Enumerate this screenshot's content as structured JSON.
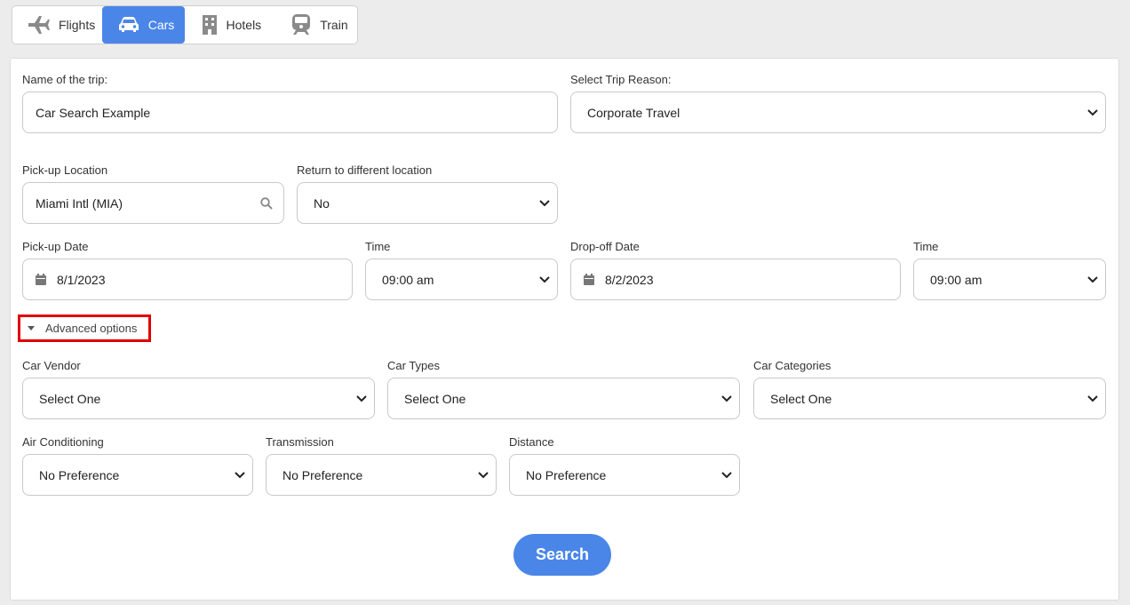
{
  "tabs": [
    {
      "label": "Flights",
      "icon": "plane-icon",
      "active": false
    },
    {
      "label": "Cars",
      "icon": "car-icon",
      "active": true
    },
    {
      "label": "Hotels",
      "icon": "building-icon",
      "active": false
    },
    {
      "label": "Train",
      "icon": "train-icon",
      "active": false
    }
  ],
  "colors": {
    "accent": "#4a86e8",
    "highlight_border": "#e00000"
  },
  "trip": {
    "name_label": "Name of the trip:",
    "name_value": "Car Search Example",
    "reason_label": "Select Trip Reason:",
    "reason_value": "Corporate Travel"
  },
  "pickup": {
    "location_label": "Pick-up Location",
    "location_value": "Miami Intl (MIA)",
    "return_label": "Return to different location",
    "return_value": "No",
    "date_label": "Pick-up Date",
    "date_value": "8/1/2023",
    "time_label": "Time",
    "time_value": "09:00 am"
  },
  "dropoff": {
    "date_label": "Drop-off Date",
    "date_value": "8/2/2023",
    "time_label": "Time",
    "time_value": "09:00 am"
  },
  "advanced": {
    "toggle_label": "Advanced options",
    "vendor_label": "Car Vendor",
    "vendor_value": "Select One",
    "types_label": "Car Types",
    "types_value": "Select One",
    "categories_label": "Car Categories",
    "categories_value": "Select One",
    "ac_label": "Air Conditioning",
    "ac_value": "No Preference",
    "transmission_label": "Transmission",
    "transmission_value": "No Preference",
    "distance_label": "Distance",
    "distance_value": "No Preference"
  },
  "search_label": "Search"
}
